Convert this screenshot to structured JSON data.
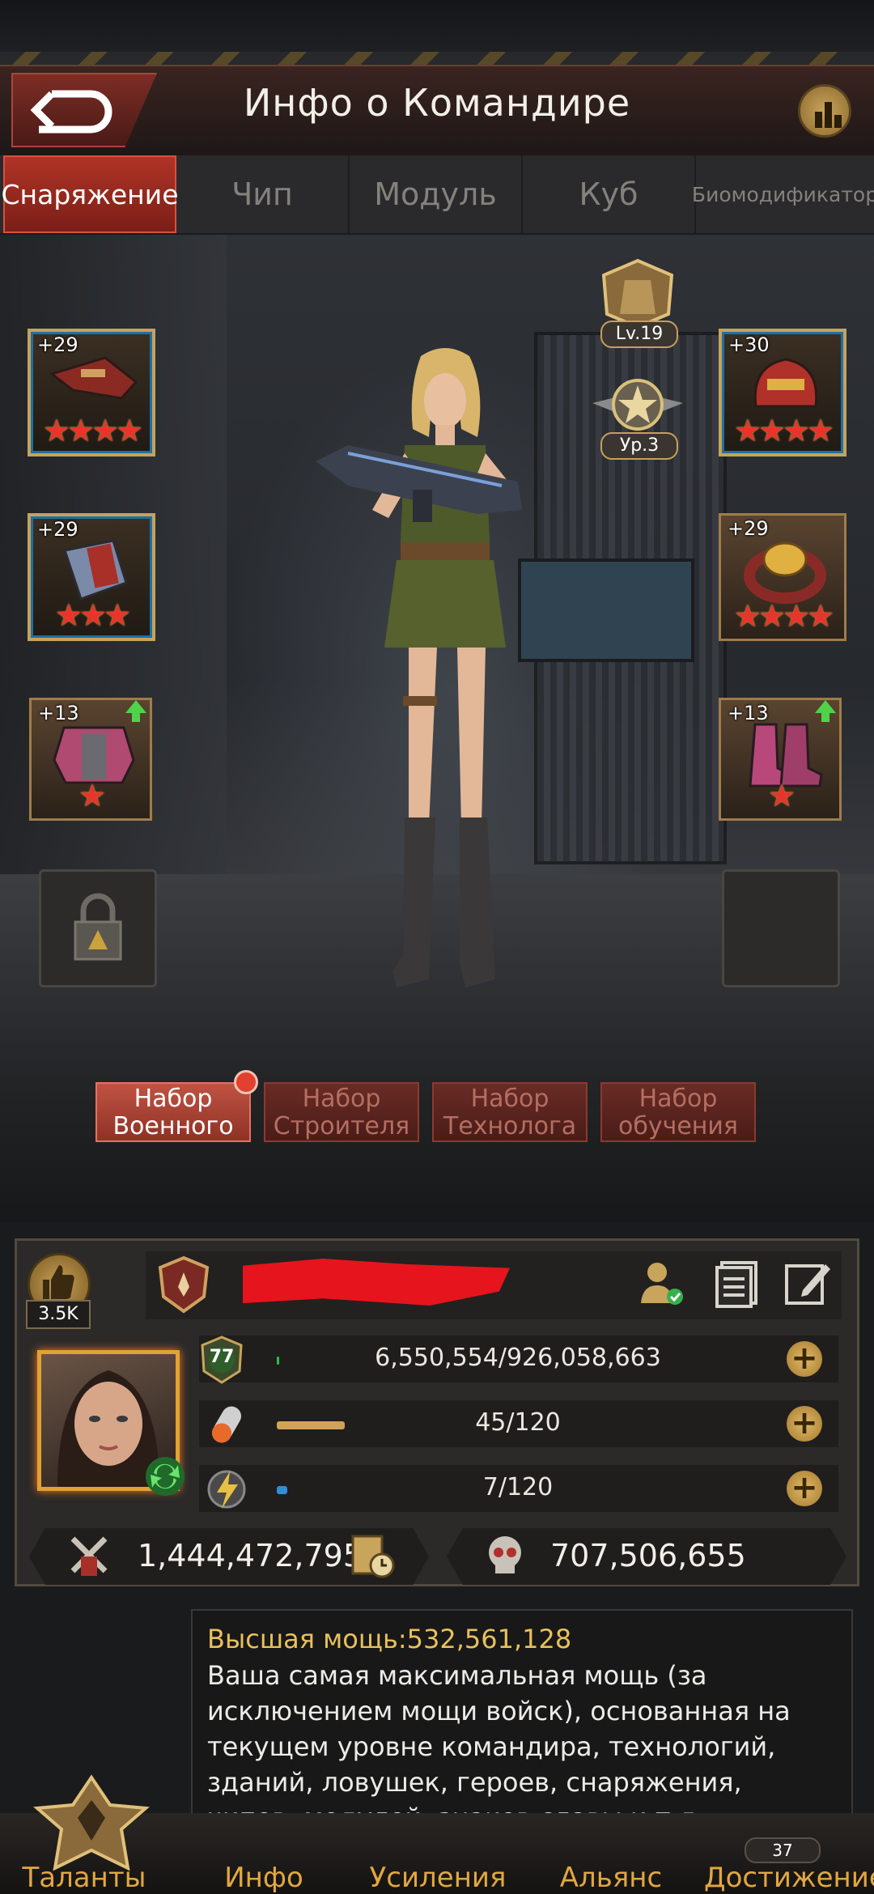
{
  "header": {
    "title": "Инфо о Командире"
  },
  "tabs": [
    {
      "label": "Снаряжение",
      "active": true
    },
    {
      "label": "Чип"
    },
    {
      "label": "Модуль"
    },
    {
      "label": "Куб"
    },
    {
      "label": "Биомодификатор"
    }
  ],
  "equipment": {
    "weapon": {
      "level": "+29",
      "stars": "★★★★",
      "star_count": 4,
      "icon": "rifle-icon"
    },
    "helmet": {
      "level": "+30",
      "stars": "★★★★",
      "star_count": 4,
      "icon": "helmet-icon"
    },
    "gloves": {
      "level": "+29",
      "stars": "★★★",
      "star_count": 3,
      "icon": "glove-icon"
    },
    "ring": {
      "level": "+29",
      "stars": "★★★★",
      "star_count": 4,
      "icon": "ring-icon"
    },
    "armor": {
      "level": "+13",
      "stars": "★",
      "star_count": 1,
      "icon": "armor-icon",
      "upgrade": true
    },
    "boots": {
      "level": "+13",
      "stars": "★",
      "star_count": 1,
      "icon": "boots-icon",
      "upgrade": true
    }
  },
  "badges": {
    "armor_level": "Lv.19",
    "rank_level": "Ур.3"
  },
  "sets": [
    {
      "line1": "Набор",
      "line2": "Военного",
      "active": true,
      "notification": true
    },
    {
      "line1": "Набор",
      "line2": "Строителя"
    },
    {
      "line1": "Набор",
      "line2": "Технолога"
    },
    {
      "line1": "Набор",
      "line2": "обучения"
    }
  ],
  "profile": {
    "likes": "3.5K",
    "level": "77",
    "exp": {
      "text": "6,550,554/926,058,663",
      "fraction": 0.007
    },
    "stamina": {
      "text": "45/120",
      "fraction": 0.375
    },
    "energy": {
      "text": "7/120",
      "fraction": 0.058
    },
    "power": "1,444,472,795",
    "kills": "707,506,655"
  },
  "tooltip": {
    "title": "Высшая мощь:532,561,128",
    "body": "Ваша самая максимальная мощь (за исключением мощи войск), основанная на текущем уровне командира, технологий, зданий, ловушек, героев, снаряжения, чипов, модулей, знаков славы и т.д."
  },
  "nav": [
    {
      "label": "Таланты"
    },
    {
      "label": "Инфо"
    },
    {
      "label": "Усиления"
    },
    {
      "label": "Альянс"
    },
    {
      "label": "Достижение",
      "badge": "37"
    }
  ],
  "colors": {
    "accent": "#b03426",
    "gold": "#e2a740",
    "exp_bar": "#2bbf4a",
    "stamina_bar": "#d4a256",
    "energy_bar": "#2e8fd6"
  }
}
